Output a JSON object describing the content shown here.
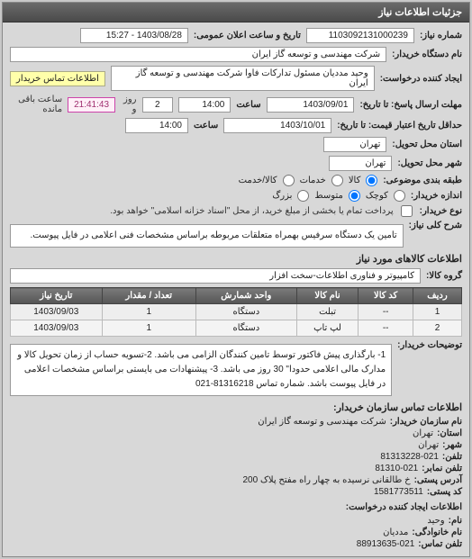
{
  "header": {
    "title": "جزئیات اطلاعات نیاز"
  },
  "top": {
    "req_no_label": "شماره نیاز:",
    "req_no": "1103092131000239",
    "pub_dt_label": "تاریخ و ساعت اعلان عمومی:",
    "pub_dt": "1403/08/28 - 15:27",
    "buyer_org_label": "نام دستگاه خریدار:",
    "buyer_org": "شرکت مهندسی و توسعه گاز ایران",
    "requester_label": "ایجاد کننده درخواست:",
    "requester": "وحید مددیان مسئول تدارکات فاوا شرکت مهندسی و توسعه گاز ایران",
    "contact_link": "اطلاعات تماس خریدار",
    "deadline_label": "مهلت ارسال پاسخ: تا تاریخ:",
    "deadline_date": "1403/09/01",
    "deadline_time_label": "ساعت",
    "deadline_time": "14:00",
    "days_label": "روز و",
    "days_left": "2",
    "countdown": "21:41:43",
    "remain_label": "ساعت باقی مانده",
    "validity_label": "حداقل تاریخ اعتبار قیمت: تا تاریخ:",
    "validity_date": "1403/10/01",
    "validity_time_label": "ساعت",
    "validity_time": "14:00",
    "delivery_state_label": "استان محل تحویل:",
    "delivery_state": "تهران",
    "delivery_city_label": "شهر محل تحویل:",
    "delivery_city": "تهران",
    "budget_label": "طبقه بندی موضوعی:",
    "radios": {
      "kala": "کالا",
      "khedmat": "کالا/خدمت",
      "khadamat": "خدمات"
    },
    "size_label": "اندازه خریدار:",
    "size_radios": {
      "small": "کوچک",
      "mid": "متوسط",
      "large": "بزرگ"
    },
    "cart_label": "نوع خریدار:",
    "cart_note": "پرداخت تمام یا بخشی از مبلغ خرید، از محل \"اسناد خزانه اسلامی\" خواهد بود.",
    "desc_label": "شرح کلی نیاز:",
    "desc": "تامین یک دستگاه سرفیس بهمراه متعلقات مربوطه براساس مشخصات فنی اعلامی در فایل پیوست."
  },
  "items": {
    "section_title": "اطلاعات کالاهای مورد نیاز",
    "group_label": "گروه کالا:",
    "group": "کامپیوتر و فناوری اطلاعات-سخت افزار",
    "columns": [
      "ردیف",
      "کد کالا",
      "نام کالا",
      "واحد شمارش",
      "تعداد / مقدار",
      "تاریخ نیاز"
    ],
    "rows": [
      {
        "idx": "1",
        "code": "--",
        "name": "تبلت",
        "unit": "دستگاه",
        "qty": "1",
        "date": "1403/09/03"
      },
      {
        "idx": "2",
        "code": "--",
        "name": "لپ تاپ",
        "unit": "دستگاه",
        "qty": "1",
        "date": "1403/09/03"
      }
    ],
    "buyer_note_label": "توضیحات خریدار:",
    "buyer_note": "1- بارگذاری پیش فاکتور توسط تامین کنندگان الزامی می باشد. 2-تسویه حساب از زمان تحویل کالا و مدارک مالی اعلامی حدودا\" 30 روز می باشد. 3- پیشنهادات می بایستی براساس مشخصات اعلامی در فایل پیوست باشد. شماره تماس 81316218-021"
  },
  "contacts": {
    "section_title": "اطلاعات تماس سازمان خریدار:",
    "org_label": "نام سازمان خریدار:",
    "org": "شرکت مهندسی و توسعه گاز ایران",
    "prov_label": "استان:",
    "prov": "تهران",
    "city_label": "شهر:",
    "city": "تهران",
    "tel_label": "تلفن:",
    "tel": "81313228-021",
    "fax_label": "تلفن نمابر:",
    "fax": "81310-021",
    "addr_label": "آدرس پستی:",
    "addr": "خ طالقانی نرسیده به چهار راه مفتح پلاک 200",
    "postcode_label": "کد پستی:",
    "postcode": "1581773511",
    "creator_title": "اطلاعات ایجاد کننده درخواست:",
    "name_label": "نام:",
    "name": "وحید",
    "lname_label": "نام خانوادگی:",
    "lname": "مددیان",
    "ctel_label": "تلفن تماس:",
    "ctel": "88913635-021"
  }
}
